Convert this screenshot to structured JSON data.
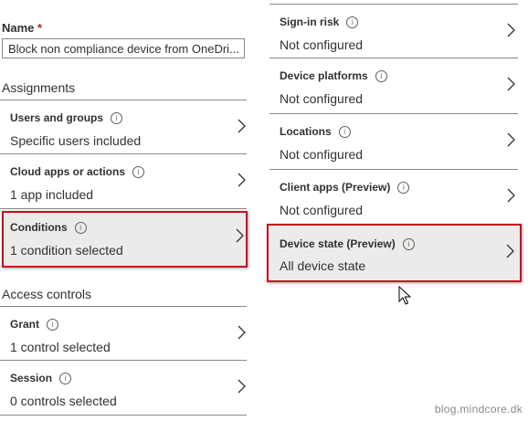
{
  "name_field": {
    "label": "Name",
    "required_marker": "*",
    "value": "Block non compliance device from OneDri..."
  },
  "assignments": {
    "title": "Assignments",
    "items": [
      {
        "title": "Users and groups",
        "value": "Specific users included"
      },
      {
        "title": "Cloud apps or actions",
        "value": "1 app included"
      },
      {
        "title": "Conditions",
        "value": "1 condition selected"
      }
    ]
  },
  "access_controls": {
    "title": "Access controls",
    "items": [
      {
        "title": "Grant",
        "value": "1 control selected"
      },
      {
        "title": "Session",
        "value": "0 controls selected"
      }
    ]
  },
  "conditions_panel": {
    "items": [
      {
        "title": "Sign-in risk",
        "value": "Not configured"
      },
      {
        "title": "Device platforms",
        "value": "Not configured"
      },
      {
        "title": "Locations",
        "value": "Not configured"
      },
      {
        "title": "Client apps (Preview)",
        "value": "Not configured"
      },
      {
        "title": "Device state (Preview)",
        "value": "All device state"
      }
    ]
  },
  "watermark": "blog.mindcore.dk",
  "colors": {
    "highlight": "#c50f1f",
    "selected_bg": "#edebe9",
    "required": "#a4262c"
  }
}
